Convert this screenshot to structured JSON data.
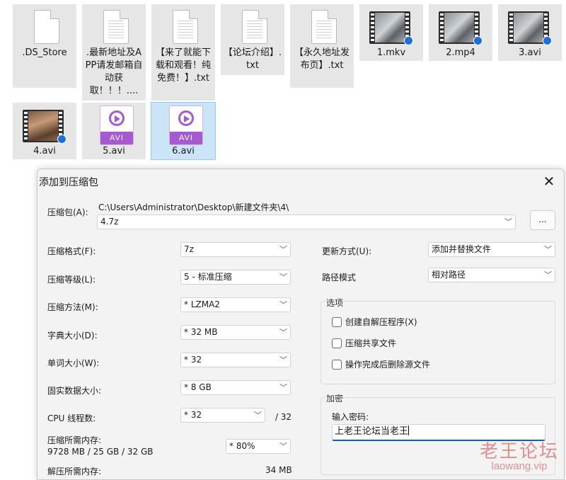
{
  "files": [
    {
      "name": ".DS_Store",
      "icon": "document-icon"
    },
    {
      "name": ".最新地址及APP请发邮箱自动获取！！！....",
      "icon": "document-icon"
    },
    {
      "name": "【来了就能下载和观看！纯免费！】.txt",
      "icon": "document-icon"
    },
    {
      "name": "【论坛介绍】.txt",
      "icon": "document-icon"
    },
    {
      "name": "【永久地址发布页】.txt",
      "icon": "document-icon"
    },
    {
      "name": "1.mkv",
      "icon": "video-thumbnail-icon"
    },
    {
      "name": "2.mp4",
      "icon": "video-thumbnail-icon"
    },
    {
      "name": "3.avi",
      "icon": "video-thumbnail-icon"
    },
    {
      "name": "4.avi",
      "icon": "video-thumbnail-icon"
    },
    {
      "name": "5.avi",
      "icon": "avi-file-icon",
      "badge": "AVI"
    },
    {
      "name": "6.avi",
      "icon": "avi-file-icon",
      "badge": "AVI",
      "selected": true
    }
  ],
  "dialog": {
    "title": "添加到压缩包",
    "archive_label": "压缩包(A):",
    "archive_path": "C:\\Users\\Administrator\\Desktop\\新建文件夹\\4\\",
    "archive_name": "4.7z",
    "browse_label": "...",
    "left": [
      {
        "label": "压缩格式(F):",
        "value": "7z"
      },
      {
        "label": "压缩等级(L):",
        "value": "5 - 标准压缩"
      },
      {
        "label": "压缩方法(M):",
        "value": "*  LZMA2"
      },
      {
        "label": "字典大小(D):",
        "value": "*  32 MB"
      },
      {
        "label": "单词大小(W):",
        "value": "*  32"
      },
      {
        "label": "固实数据大小:",
        "value": "*  8 GB"
      }
    ],
    "cpu": {
      "label": "CPU 线程数:",
      "value": "*  32",
      "max": "/ 32"
    },
    "mem": {
      "label": "压缩所需内存:",
      "detail": "9728 MB / 25 GB / 32 GB",
      "value": "*  80%"
    },
    "decomp": {
      "label": "解压所需内存:",
      "value": "34 MB"
    },
    "update": {
      "label": "更新方式(U):",
      "value": "添加并替换文件"
    },
    "path_mode": {
      "label": "路径模式",
      "value": "相对路径"
    },
    "options": {
      "title": "选项",
      "items": [
        "创建自解压程序(X)",
        "压缩共享文件",
        "操作完成后删除源文件"
      ]
    },
    "encryption": {
      "title": "加密",
      "password_label": "输入密码:",
      "password_value": "上老王论坛当老王"
    }
  },
  "watermark": {
    "line1": "老王论坛",
    "line2": "laowang.vip"
  }
}
